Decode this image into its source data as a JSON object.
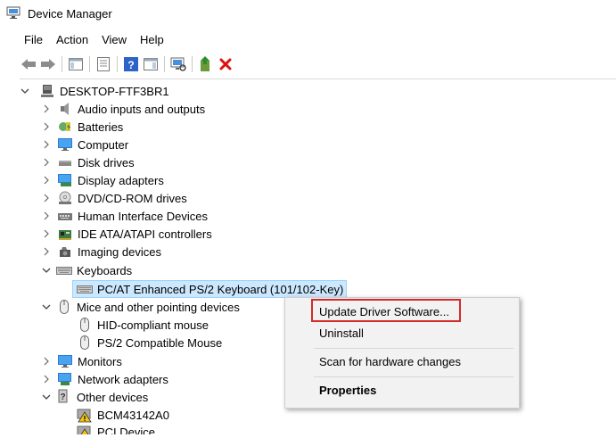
{
  "window": {
    "title": "Device Manager"
  },
  "menu": [
    "File",
    "Action",
    "View",
    "Help"
  ],
  "toolbar_icons": [
    "back-arrow-icon",
    "forward-arrow-icon",
    "show-hide-console-tree-icon",
    "properties-icon",
    "help-icon",
    "action-pane-icon",
    "scan-hardware-icon",
    "update-driver-icon",
    "uninstall-x-icon"
  ],
  "tree": {
    "root": "DESKTOP-FTF3BR1",
    "categories": [
      {
        "label": "Audio inputs and outputs",
        "icon": "speaker-icon",
        "expanded": false
      },
      {
        "label": "Batteries",
        "icon": "battery-icon",
        "expanded": false
      },
      {
        "label": "Computer",
        "icon": "computer-icon",
        "expanded": false
      },
      {
        "label": "Disk drives",
        "icon": "disk-drive-icon",
        "expanded": false
      },
      {
        "label": "Display adapters",
        "icon": "display-adapter-icon",
        "expanded": false
      },
      {
        "label": "DVD/CD-ROM drives",
        "icon": "dvd-drive-icon",
        "expanded": false
      },
      {
        "label": "Human Interface Devices",
        "icon": "hid-icon",
        "expanded": false
      },
      {
        "label": "IDE ATA/ATAPI controllers",
        "icon": "ide-controller-icon",
        "expanded": false
      },
      {
        "label": "Imaging devices",
        "icon": "camera-icon",
        "expanded": false
      },
      {
        "label": "Keyboards",
        "icon": "keyboard-icon",
        "expanded": true,
        "children": [
          "PC/AT Enhanced PS/2 Keyboard (101/102-Key)"
        ]
      },
      {
        "label": "Mice and other pointing devices",
        "icon": "mouse-icon",
        "expanded": true,
        "children": [
          "HID-compliant mouse",
          "PS/2 Compatible Mouse"
        ]
      },
      {
        "label": "Monitors",
        "icon": "monitor-icon",
        "expanded": false
      },
      {
        "label": "Network adapters",
        "icon": "network-adapter-icon",
        "expanded": false
      },
      {
        "label": "Other devices",
        "icon": "unknown-device-icon",
        "expanded": true,
        "children": [
          "BCM43142A0",
          "PCI Device"
        ]
      }
    ]
  },
  "context_menu": {
    "items": [
      "Update Driver Software...",
      "Uninstall",
      "Scan for hardware changes",
      "Properties"
    ]
  },
  "colors": {
    "selection": "#cce8ff",
    "highlight_border": "#d42a2a",
    "folder_blue": "#1e7fd8"
  }
}
